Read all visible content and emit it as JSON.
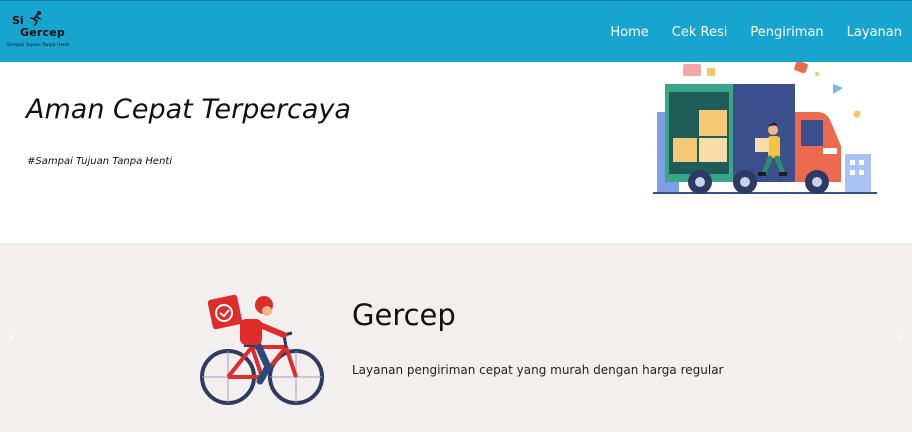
{
  "brand": {
    "line1": "Si",
    "line2": "Gercep",
    "tagline": "Sampai Tujuan Tanpa Henti"
  },
  "nav": {
    "items": [
      {
        "label": "Home",
        "icon": ""
      },
      {
        "label": "Cek Resi",
        "icon": ""
      },
      {
        "label": "Pengiriman",
        "icon": ""
      },
      {
        "label": "Layanan",
        "icon": ""
      }
    ]
  },
  "hero": {
    "title": "Aman Cepat Terpercaya",
    "subtitle": "#Sampai Tujuan Tanpa Henti",
    "illustration": "delivery-truck-illustration"
  },
  "carousel": {
    "slide": {
      "title": "Gercep",
      "description": "Layanan pengiriman cepat yang murah dengan harga regular",
      "illustration": "bicycle-courier-illustration"
    },
    "prev_icon": "‹",
    "next_icon": "›"
  },
  "colors": {
    "navbar": "#17a4cf",
    "carousel_bg": "#f3efee",
    "accent_red": "#e02b2b"
  }
}
